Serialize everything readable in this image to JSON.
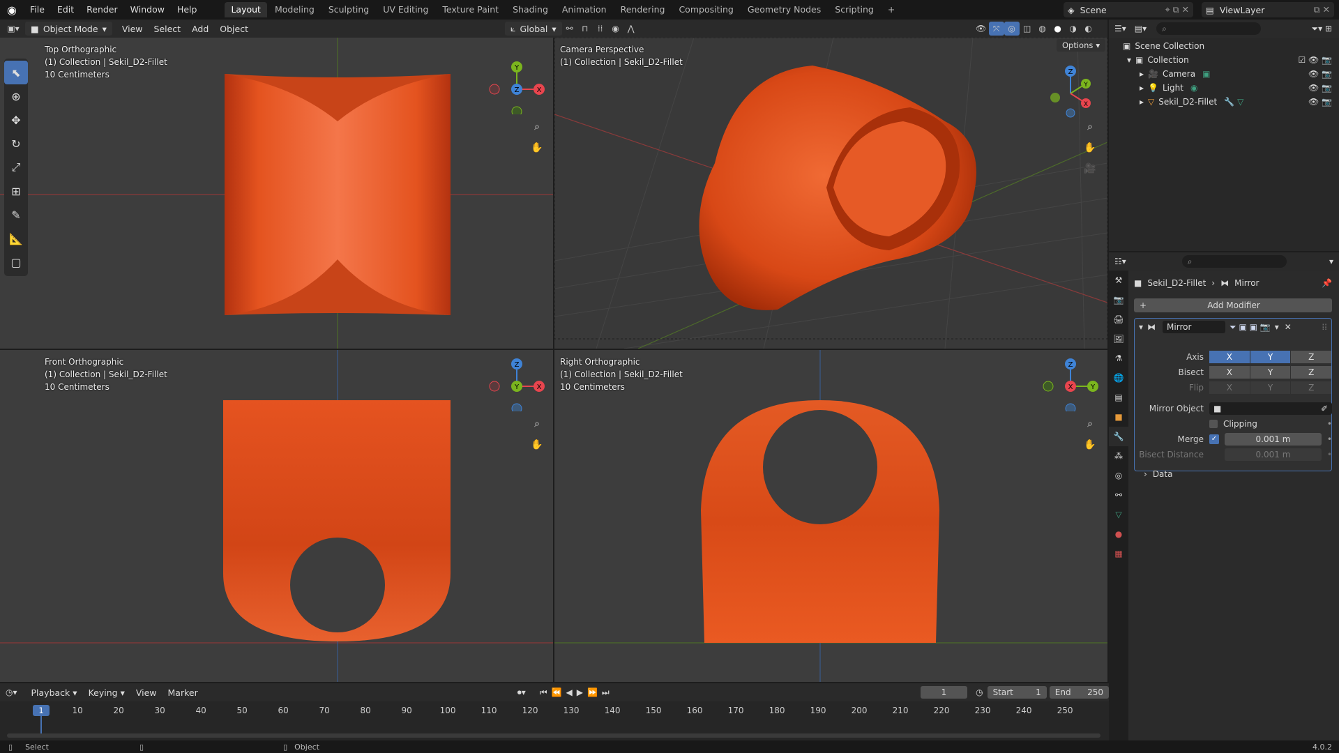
{
  "topbar": {
    "menus": [
      "File",
      "Edit",
      "Render",
      "Window",
      "Help"
    ],
    "workspaces": [
      "Layout",
      "Modeling",
      "Sculpting",
      "UV Editing",
      "Texture Paint",
      "Shading",
      "Animation",
      "Rendering",
      "Compositing",
      "Geometry Nodes",
      "Scripting"
    ],
    "active_workspace": "Layout",
    "scene": "Scene",
    "view_layer": "ViewLayer"
  },
  "viewport_header": {
    "mode": "Object Mode",
    "menus": [
      "View",
      "Select",
      "Add",
      "Object"
    ],
    "transform_orientation": "Global",
    "options_label": "Options"
  },
  "viewports": {
    "top": {
      "title": "Top Orthographic",
      "collection": "(1) Collection | Sekil_D2-Fillet",
      "scale": "10 Centimeters"
    },
    "camera": {
      "title": "Camera Perspective",
      "collection": "(1) Collection | Sekil_D2-Fillet"
    },
    "front": {
      "title": "Front Orthographic",
      "collection": "(1) Collection | Sekil_D2-Fillet",
      "scale": "10 Centimeters"
    },
    "right": {
      "title": "Right Orthographic",
      "collection": "(1) Collection | Sekil_D2-Fillet",
      "scale": "10 Centimeters"
    }
  },
  "gizmo": {
    "x": "X",
    "y": "Y",
    "z": "Z"
  },
  "outliner": {
    "scene_collection": "Scene Collection",
    "collection": "Collection",
    "items": [
      "Camera",
      "Light",
      "Sekil_D2-Fillet"
    ]
  },
  "properties": {
    "breadcrumb_object": "Sekil_D2-Fillet",
    "breadcrumb_modifier": "Mirror",
    "add_modifier": "Add Modifier",
    "modifier_name": "Mirror",
    "axis_label": "Axis",
    "bisect_label": "Bisect",
    "flip_label": "Flip",
    "axes": [
      "X",
      "Y",
      "Z"
    ],
    "mirror_object_label": "Mirror Object",
    "clipping_label": "Clipping",
    "merge_label": "Merge",
    "merge_value": "0.001 m",
    "bisect_distance_label": "Bisect Distance",
    "bisect_distance_value": "0.001 m",
    "data_label": "Data"
  },
  "timeline": {
    "menus": [
      "Playback",
      "Keying",
      "View",
      "Marker"
    ],
    "current_frame": "1",
    "start_label": "Start",
    "start_value": "1",
    "end_label": "End",
    "end_value": "250",
    "ticks": [
      "10",
      "20",
      "30",
      "40",
      "50",
      "60",
      "70",
      "80",
      "90",
      "100",
      "110",
      "120",
      "130",
      "140",
      "150",
      "160",
      "170",
      "180",
      "190",
      "200",
      "210",
      "220",
      "230",
      "240",
      "250"
    ],
    "playhead": "1"
  },
  "statusbar": {
    "select": "Select",
    "object": "Object",
    "version": "4.0.2"
  },
  "colors": {
    "accent": "#4772b3",
    "object_orange": "#e8521c",
    "axis_x": "#e8454e",
    "axis_y": "#7bb51e",
    "axis_z": "#3f83d6"
  }
}
